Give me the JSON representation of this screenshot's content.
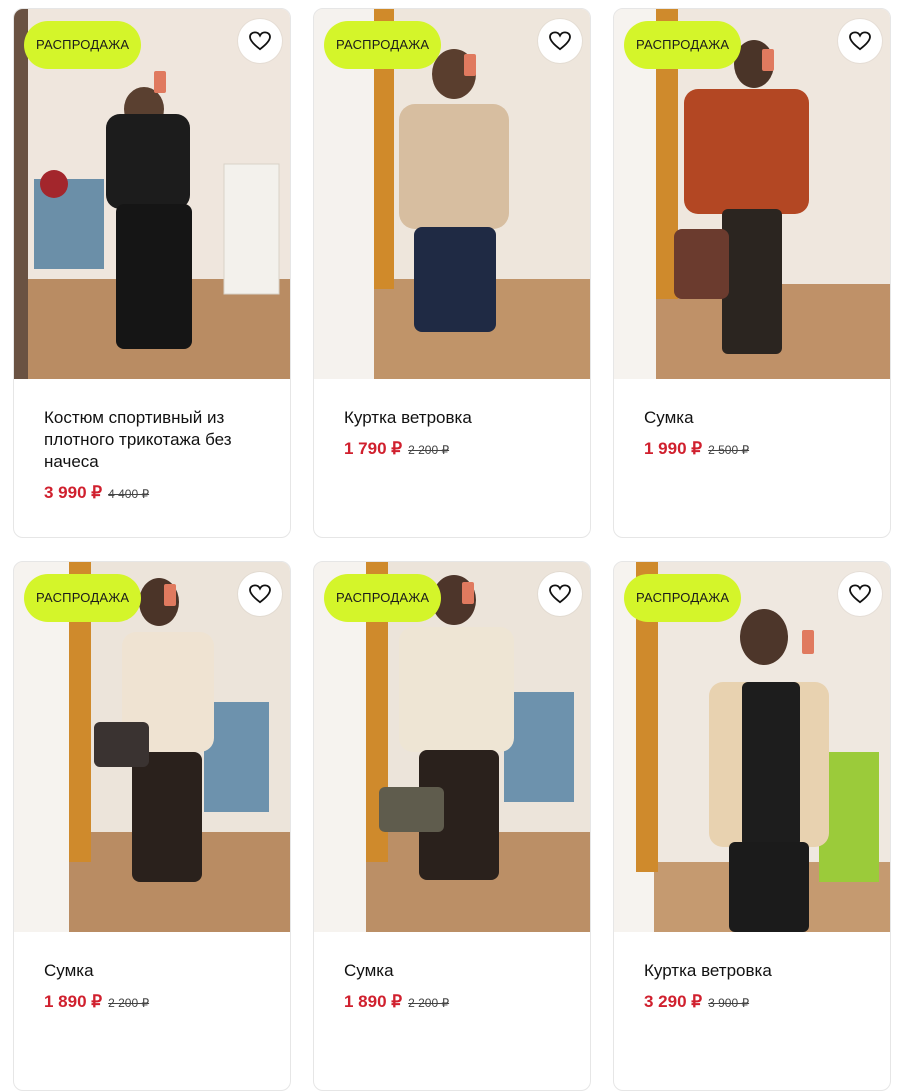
{
  "colors": {
    "badge_bg": "#d4f52a",
    "price": "#d0202e"
  },
  "products": [
    {
      "badge": "РАСПРОДАЖА",
      "title": "Костюм спортивный из плотного трикотажа без начеса",
      "price": "3 990 ₽",
      "old_price": "4 400 ₽",
      "fav_icon": "heart-outline-icon"
    },
    {
      "badge": "РАСПРОДАЖА",
      "title": "Куртка ветровка",
      "price": "1 790 ₽",
      "old_price": "2 200 ₽",
      "fav_icon": "heart-outline-icon"
    },
    {
      "badge": "РАСПРОДАЖА",
      "title": "Сумка",
      "price": "1 990 ₽",
      "old_price": "2 500 ₽",
      "fav_icon": "heart-outline-icon"
    },
    {
      "badge": "РАСПРОДАЖА",
      "title": "Сумка",
      "price": "1 890 ₽",
      "old_price": "2 200 ₽",
      "fav_icon": "heart-outline-icon"
    },
    {
      "badge": "РАСПРОДАЖА",
      "title": "Сумка",
      "price": "1 890 ₽",
      "old_price": "2 200 ₽",
      "fav_icon": "heart-outline-icon"
    },
    {
      "badge": "РАСПРОДАЖА",
      "title": "Куртка ветровка",
      "price": "3 290 ₽",
      "old_price": "3 900 ₽",
      "fav_icon": "heart-outline-icon"
    }
  ]
}
